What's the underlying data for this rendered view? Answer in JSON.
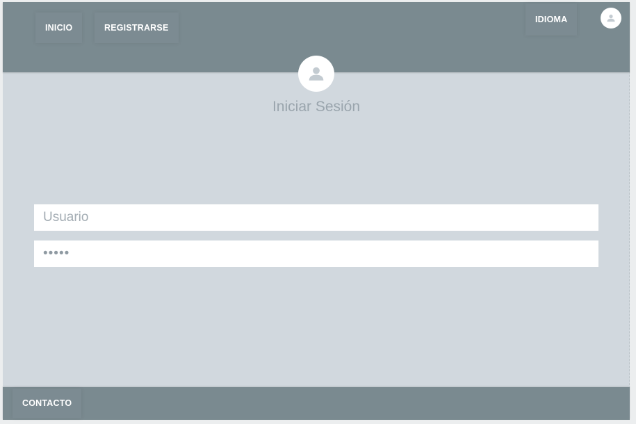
{
  "header": {
    "nav": [
      {
        "label": "INICIO"
      },
      {
        "label": "REGISTRARSE"
      }
    ],
    "language_label": "IDIOMA",
    "avatar_icon": "user-avatar-icon"
  },
  "login": {
    "avatar_icon": "user-avatar-icon",
    "title": "Iniciar Sesión",
    "username": {
      "placeholder": "Usuario",
      "value": ""
    },
    "password": {
      "value": "•••••"
    }
  },
  "footer": {
    "contact_label": "CONTACTO"
  },
  "colors": {
    "bar": "#7a8a90",
    "background": "#d1d8de",
    "text_muted": "#9aa5ad"
  }
}
